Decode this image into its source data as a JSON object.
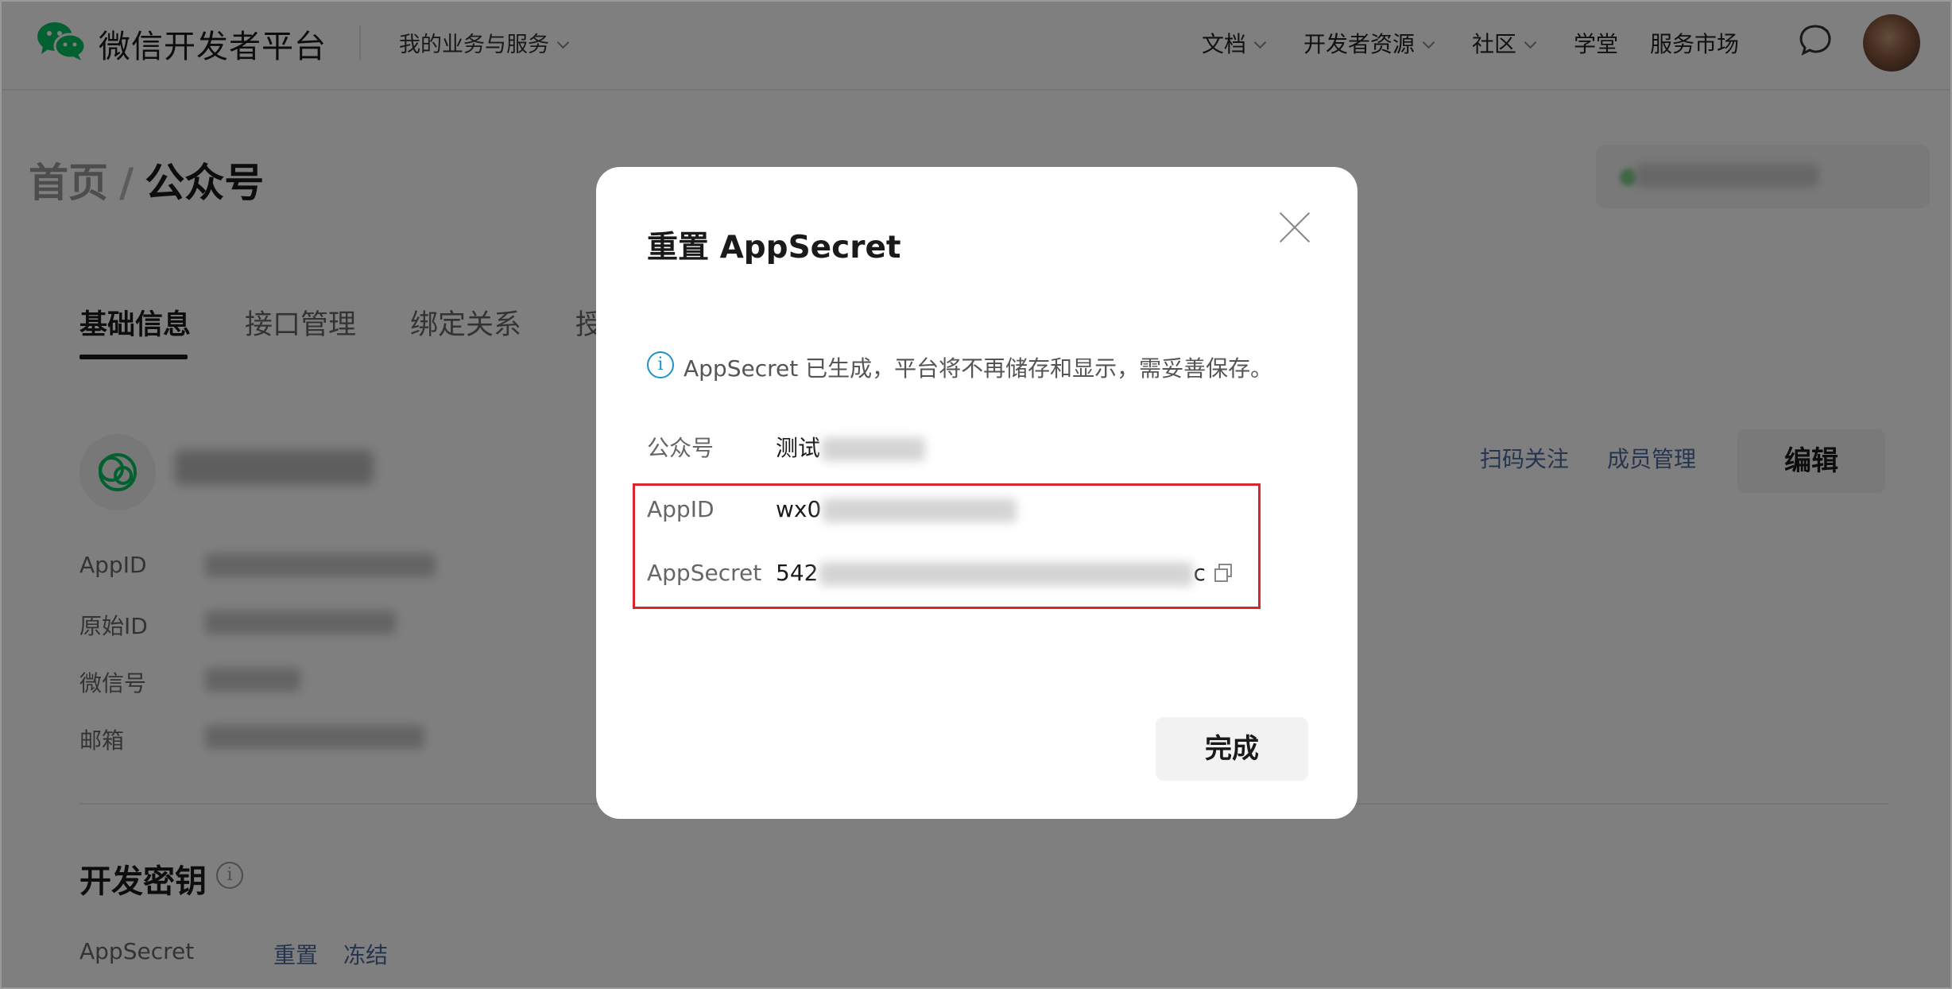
{
  "header": {
    "brand": "微信开发者平台",
    "menu": "我的业务与服务",
    "nav": [
      {
        "label": "文档",
        "dropdown": true
      },
      {
        "label": "开发者资源",
        "dropdown": true
      },
      {
        "label": "社区",
        "dropdown": true
      },
      {
        "label": "学堂",
        "dropdown": false
      },
      {
        "label": "服务市场",
        "dropdown": false
      }
    ]
  },
  "breadcrumb": {
    "home": "首页",
    "separator": "/",
    "current": "公众号"
  },
  "tabs": [
    "基础信息",
    "接口管理",
    "绑定关系",
    "授"
  ],
  "account": {
    "actions": [
      "扫码关注",
      "成员管理"
    ],
    "edit_label": "编辑",
    "info_labels": [
      "AppID",
      "原始ID",
      "微信号",
      "邮箱"
    ]
  },
  "dev_key": {
    "title": "开发密钥",
    "info_icon": "i",
    "row_label": "AppSecret",
    "actions": [
      "重置",
      "冻结"
    ]
  },
  "dialog": {
    "title": "重置 AppSecret",
    "notice_icon": "i",
    "notice": "AppSecret 已生成，平台将不再储存和显示，需妥善保存。",
    "fields": {
      "account_label": "公众号",
      "account_value_prefix": "测试",
      "appid_label": "AppID",
      "appid_value_prefix": "wx0",
      "secret_label": "AppSecret",
      "secret_value_prefix": "542",
      "secret_value_suffix": "c"
    },
    "done_label": "完成"
  },
  "colors": {
    "brand_green": "#07c160",
    "link": "#4a6aa0",
    "notice_blue": "#1d93c9",
    "highlight_red": "#d8262e"
  },
  "icons": {
    "logo": "wechat-logo-icon",
    "message": "message-icon",
    "close": "close-icon",
    "copy": "copy-icon"
  }
}
